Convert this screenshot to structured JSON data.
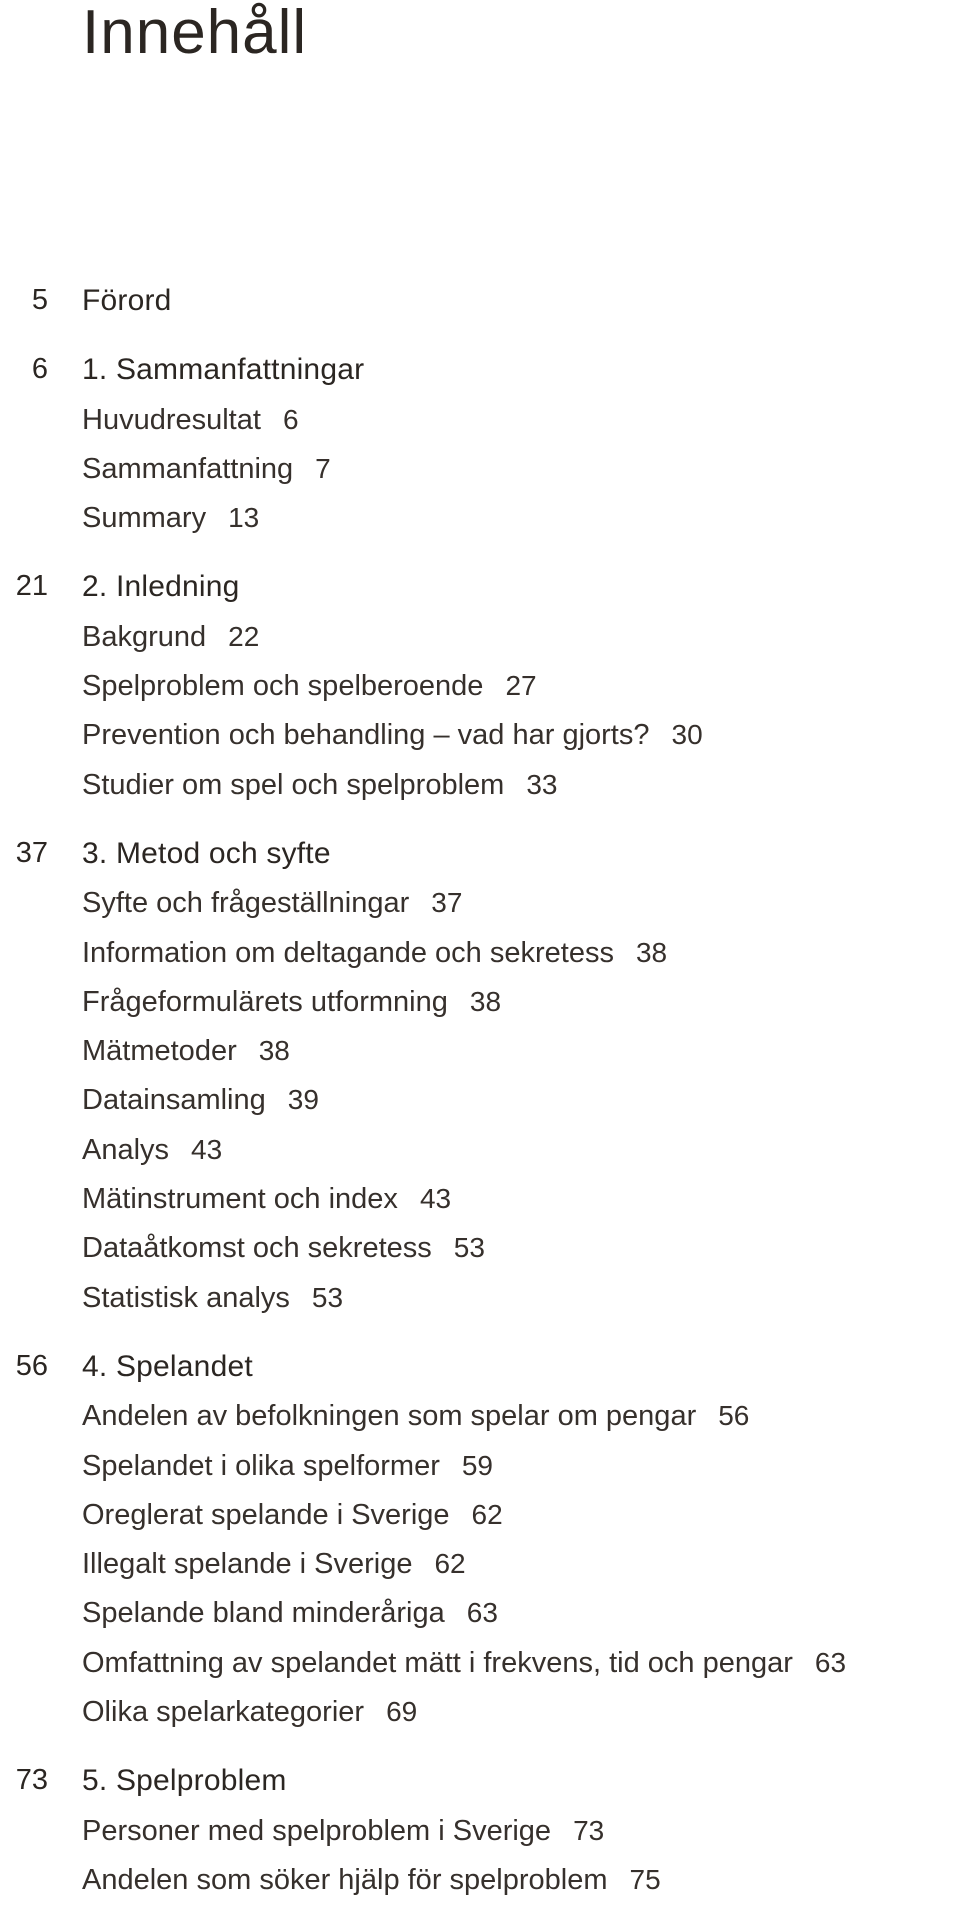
{
  "page": {
    "title": "Innehåll"
  },
  "toc": {
    "sections": [
      {
        "page": "5",
        "title": "Förord",
        "entries": []
      },
      {
        "page": "6",
        "title": "1. Sammanfattningar",
        "entries": [
          {
            "title": "Huvudresultat",
            "page": "6"
          },
          {
            "title": "Sammanfattning",
            "page": "7"
          },
          {
            "title": "Summary",
            "page": "13"
          }
        ]
      },
      {
        "page": "21",
        "title": "2. Inledning",
        "entries": [
          {
            "title": "Bakgrund",
            "page": "22"
          },
          {
            "title": "Spelproblem och spelberoende",
            "page": "27"
          },
          {
            "title": "Prevention och behandling – vad har gjorts?",
            "page": "30"
          },
          {
            "title": "Studier om spel och spelproblem",
            "page": "33"
          }
        ]
      },
      {
        "page": "37",
        "title": "3. Metod och syfte",
        "entries": [
          {
            "title": "Syfte och frågeställningar",
            "page": "37"
          },
          {
            "title": "Information om deltagande och sekretess",
            "page": "38"
          },
          {
            "title": "Frågeformulärets utformning",
            "page": "38"
          },
          {
            "title": "Mätmetoder",
            "page": "38"
          },
          {
            "title": "Datainsamling",
            "page": "39"
          },
          {
            "title": "Analys",
            "page": "43"
          },
          {
            "title": "Mätinstrument och index",
            "page": "43"
          },
          {
            "title": "Dataåtkomst och sekretess",
            "page": "53"
          },
          {
            "title": "Statistisk analys",
            "page": "53"
          }
        ]
      },
      {
        "page": "56",
        "title": "4. Spelandet",
        "entries": [
          {
            "title": "Andelen av befolkningen som spelar om pengar",
            "page": "56"
          },
          {
            "title": "Spelandet i olika spelformer",
            "page": "59"
          },
          {
            "title": "Oreglerat spelande i Sverige",
            "page": "62"
          },
          {
            "title": "Illegalt spelande i Sverige",
            "page": "62"
          },
          {
            "title": "Spelande bland minderåriga",
            "page": "63"
          },
          {
            "title": "Omfattning av spelandet mätt i frekvens, tid och pengar",
            "page": "63"
          },
          {
            "title": "Olika spelarkategorier",
            "page": "69"
          }
        ]
      },
      {
        "page": "73",
        "title": "5. Spelproblem",
        "entries": [
          {
            "title": "Personer med spelproblem i Sverige",
            "page": "73"
          },
          {
            "title": "Andelen som söker hjälp för spelproblem",
            "page": "75"
          }
        ]
      }
    ]
  }
}
